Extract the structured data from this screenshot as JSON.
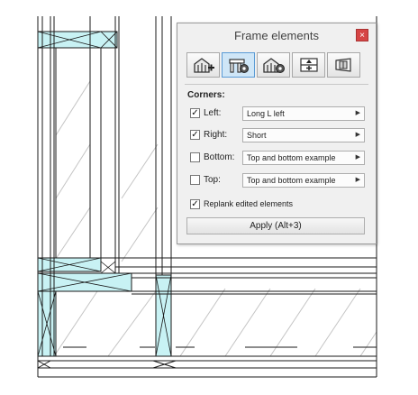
{
  "panel": {
    "title": "Frame elements",
    "close_symbol": "×",
    "tools": [
      {
        "icon": "frame-add-icon",
        "active": false
      },
      {
        "icon": "frame-settings-icon",
        "active": true
      },
      {
        "icon": "frame-gear-icon",
        "active": false
      },
      {
        "icon": "frame-split-icon",
        "active": false
      },
      {
        "icon": "frame-view-icon",
        "active": false
      }
    ],
    "corners_label": "Corners:",
    "rows": [
      {
        "label": "Left:",
        "checked": true,
        "value": "Long L left"
      },
      {
        "label": "Right:",
        "checked": true,
        "value": "Short"
      },
      {
        "label": "Bottom:",
        "checked": false,
        "value": "Top and bottom example"
      },
      {
        "label": "Top:",
        "checked": false,
        "value": "Top and bottom example"
      }
    ],
    "replank_label": "Replank edited elements",
    "replank_checked": true,
    "apply_label": "Apply (Alt+3)"
  },
  "colors": {
    "cad_line": "#1a1a1a",
    "cad_fill": "#c8f2f4",
    "cad_hatch": "#bdbdbd",
    "close_red": "#d64545",
    "active_tool": "#cfe6f7"
  },
  "check_mark": "✓",
  "dropdown_arrow": "▶"
}
